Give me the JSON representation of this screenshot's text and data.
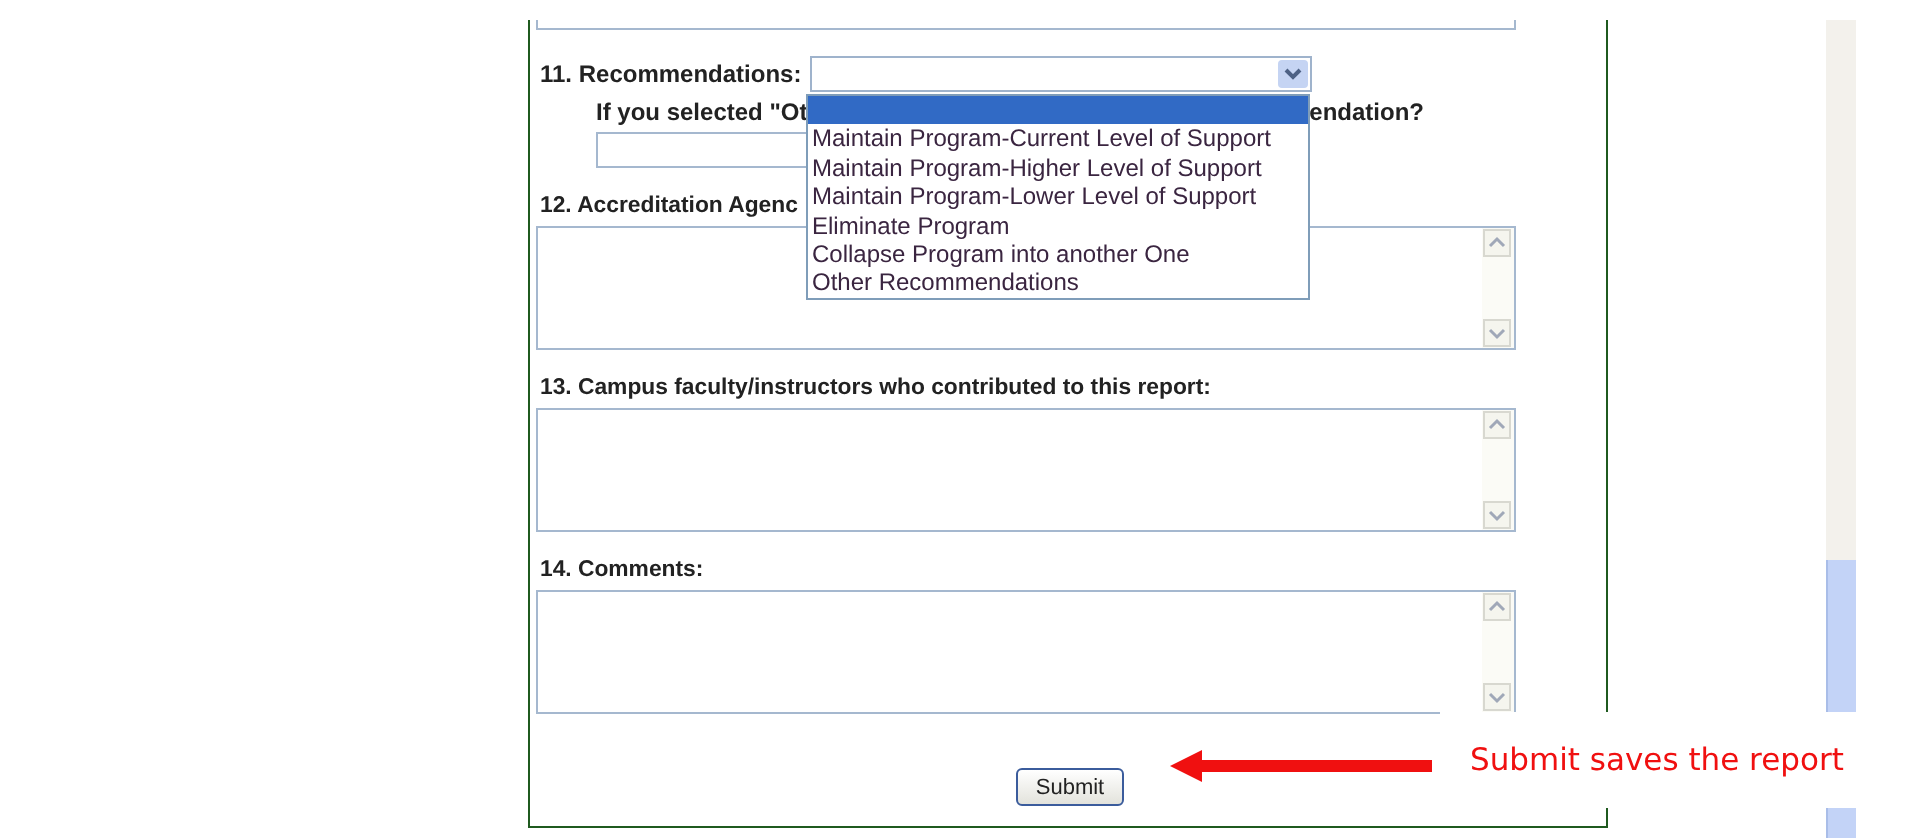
{
  "questions": [
    {
      "kind": "select",
      "label": "11. Recommendations:",
      "followup": {
        "label_start": "If you selected \"Ot",
        "label_end": "endation?"
      }
    },
    {
      "kind": "textarea",
      "label": "12. Accreditation Agenc"
    },
    {
      "kind": "textarea",
      "label": "13. Campus faculty/instructors who contributed to this report:"
    },
    {
      "kind": "textarea",
      "label": "14. Comments:"
    }
  ],
  "dropdown": {
    "options": [
      {
        "selected": true
      },
      {
        "label": "Maintain Program-Current Level of Support",
        "selected": false
      },
      {
        "label": "Maintain Program-Higher Level of Support",
        "selected": false
      },
      {
        "label": "Maintain Program-Lower Level of Support",
        "selected": false
      },
      {
        "label": "Eliminate Program",
        "selected": false
      },
      {
        "label": "Collapse Program into another One",
        "selected": false
      },
      {
        "label": "Other Recommendations",
        "selected": false
      }
    ]
  },
  "submit_button": "Submit",
  "callout": "Submit saves the report"
}
